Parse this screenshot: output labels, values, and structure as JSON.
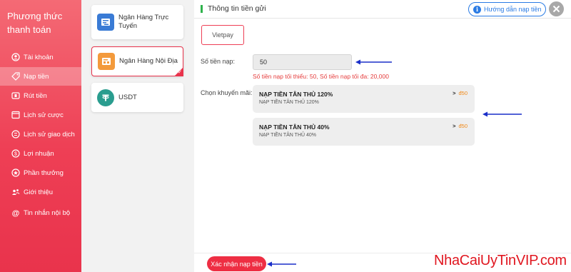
{
  "sidebar": {
    "title": "Phương thức thanh toán",
    "items": [
      {
        "label": "Tài khoản",
        "icon": "account-icon"
      },
      {
        "label": "Nạp tiền",
        "icon": "deposit-icon",
        "active": true
      },
      {
        "label": "Rút tiền",
        "icon": "withdraw-icon"
      },
      {
        "label": "Lịch sử cược",
        "icon": "bet-history-icon"
      },
      {
        "label": "Lịch sử giao dịch",
        "icon": "transaction-history-icon"
      },
      {
        "label": "Lợi nhuận",
        "icon": "profit-icon"
      },
      {
        "label": "Phần thưởng",
        "icon": "reward-icon"
      },
      {
        "label": "Giới thiệu",
        "icon": "referral-icon"
      },
      {
        "label": "Tin nhắn nội bộ",
        "icon": "message-icon"
      }
    ]
  },
  "methods": [
    {
      "label": "Ngân Hàng Trực Tuyến",
      "icon": "online-bank-icon",
      "color": "#3a7bd5"
    },
    {
      "label": "Ngân Hàng Nội Địa",
      "icon": "domestic-bank-icon",
      "color": "#f39a3c",
      "active": true
    },
    {
      "label": "USDT",
      "icon": "usdt-icon",
      "color": "#2a9d8f"
    }
  ],
  "main": {
    "header_title": "Thông tin tiền gửi",
    "guide_label": "Hướng dẫn nạp tiền",
    "channel_label": "Vietpay",
    "amount_label": "Số tiền nạp:",
    "amount_value": "50",
    "amount_hint": "Số tiền nạp tối thiểu:  50,  Số tiền nạp tối đa:  20,000",
    "promo_label": "Chọn khuyến mãi:",
    "promos": [
      {
        "title": "NẠP TIỀN TÂN THỦ 120%",
        "subtitle": "NẠP TIỀN TÂN THỦ 120%",
        "arrow": ">",
        "amount": "đ50"
      },
      {
        "title": "NẠP TIỀN TÂN THỦ 40%",
        "subtitle": "NẠP TIỀN TÂN THỦ 40%",
        "arrow": ">",
        "amount": "đ50"
      }
    ],
    "confirm_label": "Xác nhận nạp tiền"
  },
  "watermark": "NhaCaiUyTinVIP.com",
  "colors": {
    "brand_red": "#ee3f55",
    "arrow_blue": "#1a2fc9",
    "accent_green": "#2fb24c",
    "link_blue": "#2a7be4",
    "promo_orange": "#f08a1a"
  }
}
